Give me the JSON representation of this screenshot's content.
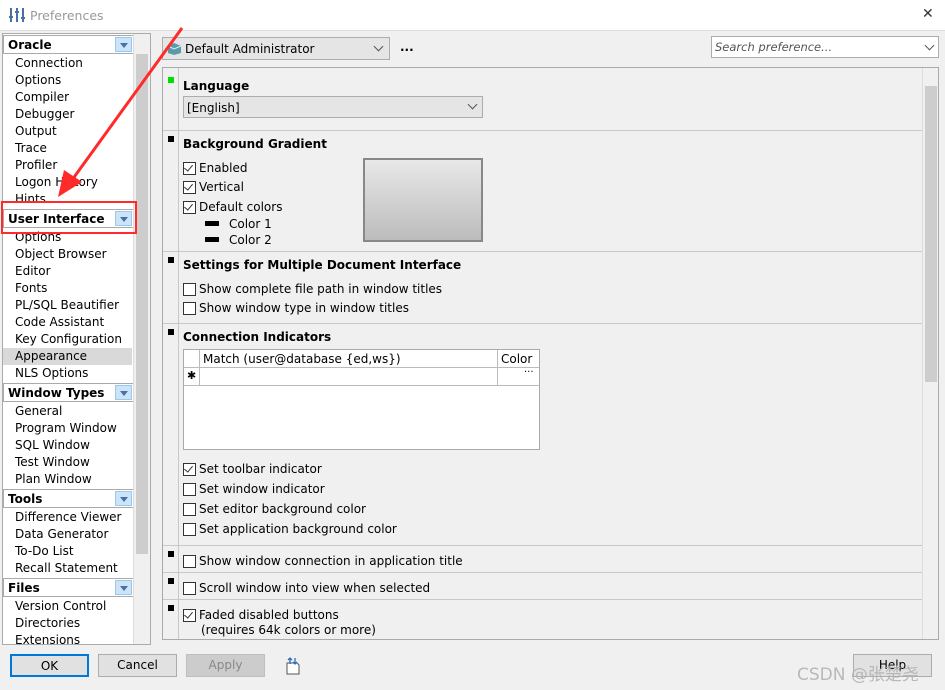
{
  "window": {
    "title": "Preferences",
    "close": "✕"
  },
  "sidebar": {
    "groups": [
      {
        "label": "Oracle",
        "items": [
          "Connection",
          "Options",
          "Compiler",
          "Debugger",
          "Output",
          "Trace",
          "Profiler",
          "Logon History",
          "Hints"
        ]
      },
      {
        "label": "User Interface",
        "items": [
          "Options",
          "Object Browser",
          "Editor",
          "Fonts",
          "PL/SQL Beautifier",
          "Code Assistant",
          "Key Configuration",
          "Appearance",
          "NLS Options"
        ],
        "selected": "Appearance"
      },
      {
        "label": "Window Types",
        "items": [
          "General",
          "Program Window",
          "SQL Window",
          "Test Window",
          "Plan Window"
        ]
      },
      {
        "label": "Tools",
        "items": [
          "Difference Viewer",
          "Data Generator",
          "To-Do List",
          "Recall Statement"
        ]
      },
      {
        "label": "Files",
        "items": [
          "Version Control",
          "Directories",
          "Extensions"
        ]
      }
    ]
  },
  "toolbar": {
    "profile": "Default Administrator",
    "more": "...",
    "search_placeholder": "Search preference..."
  },
  "sections": {
    "language": {
      "title": "Language",
      "value": "[English]"
    },
    "gradient": {
      "title": "Background Gradient",
      "enabled": "Enabled",
      "vertical": "Vertical",
      "default_colors": "Default colors",
      "color1": "Color 1",
      "color2": "Color 2"
    },
    "mdi": {
      "title": "Settings for Multiple Document Interface",
      "full_path": "Show complete file path in window titles",
      "window_type": "Show window type in window titles"
    },
    "conn": {
      "title": "Connection Indicators",
      "col_match": "Match (user@database {ed,ws})",
      "col_color": "Color",
      "new_row": "✱",
      "ellipsis": "···",
      "toolbar": "Set toolbar indicator",
      "window": "Set window indicator",
      "editor_bg": "Set editor background color",
      "app_bg": "Set application background color"
    },
    "show_conn": "Show window connection in application title",
    "scroll_view": "Scroll window into view when selected",
    "faded": "Faded disabled buttons",
    "faded_note": "(requires 64k colors or more)"
  },
  "buttons": {
    "ok": "OK",
    "cancel": "Cancel",
    "apply": "Apply",
    "help": "Help"
  },
  "watermark": "CSDN @张楚尧",
  "colors": {
    "accent": "#0078d7",
    "annotation": "#ff2a2a",
    "active_marker": "#00e000"
  }
}
